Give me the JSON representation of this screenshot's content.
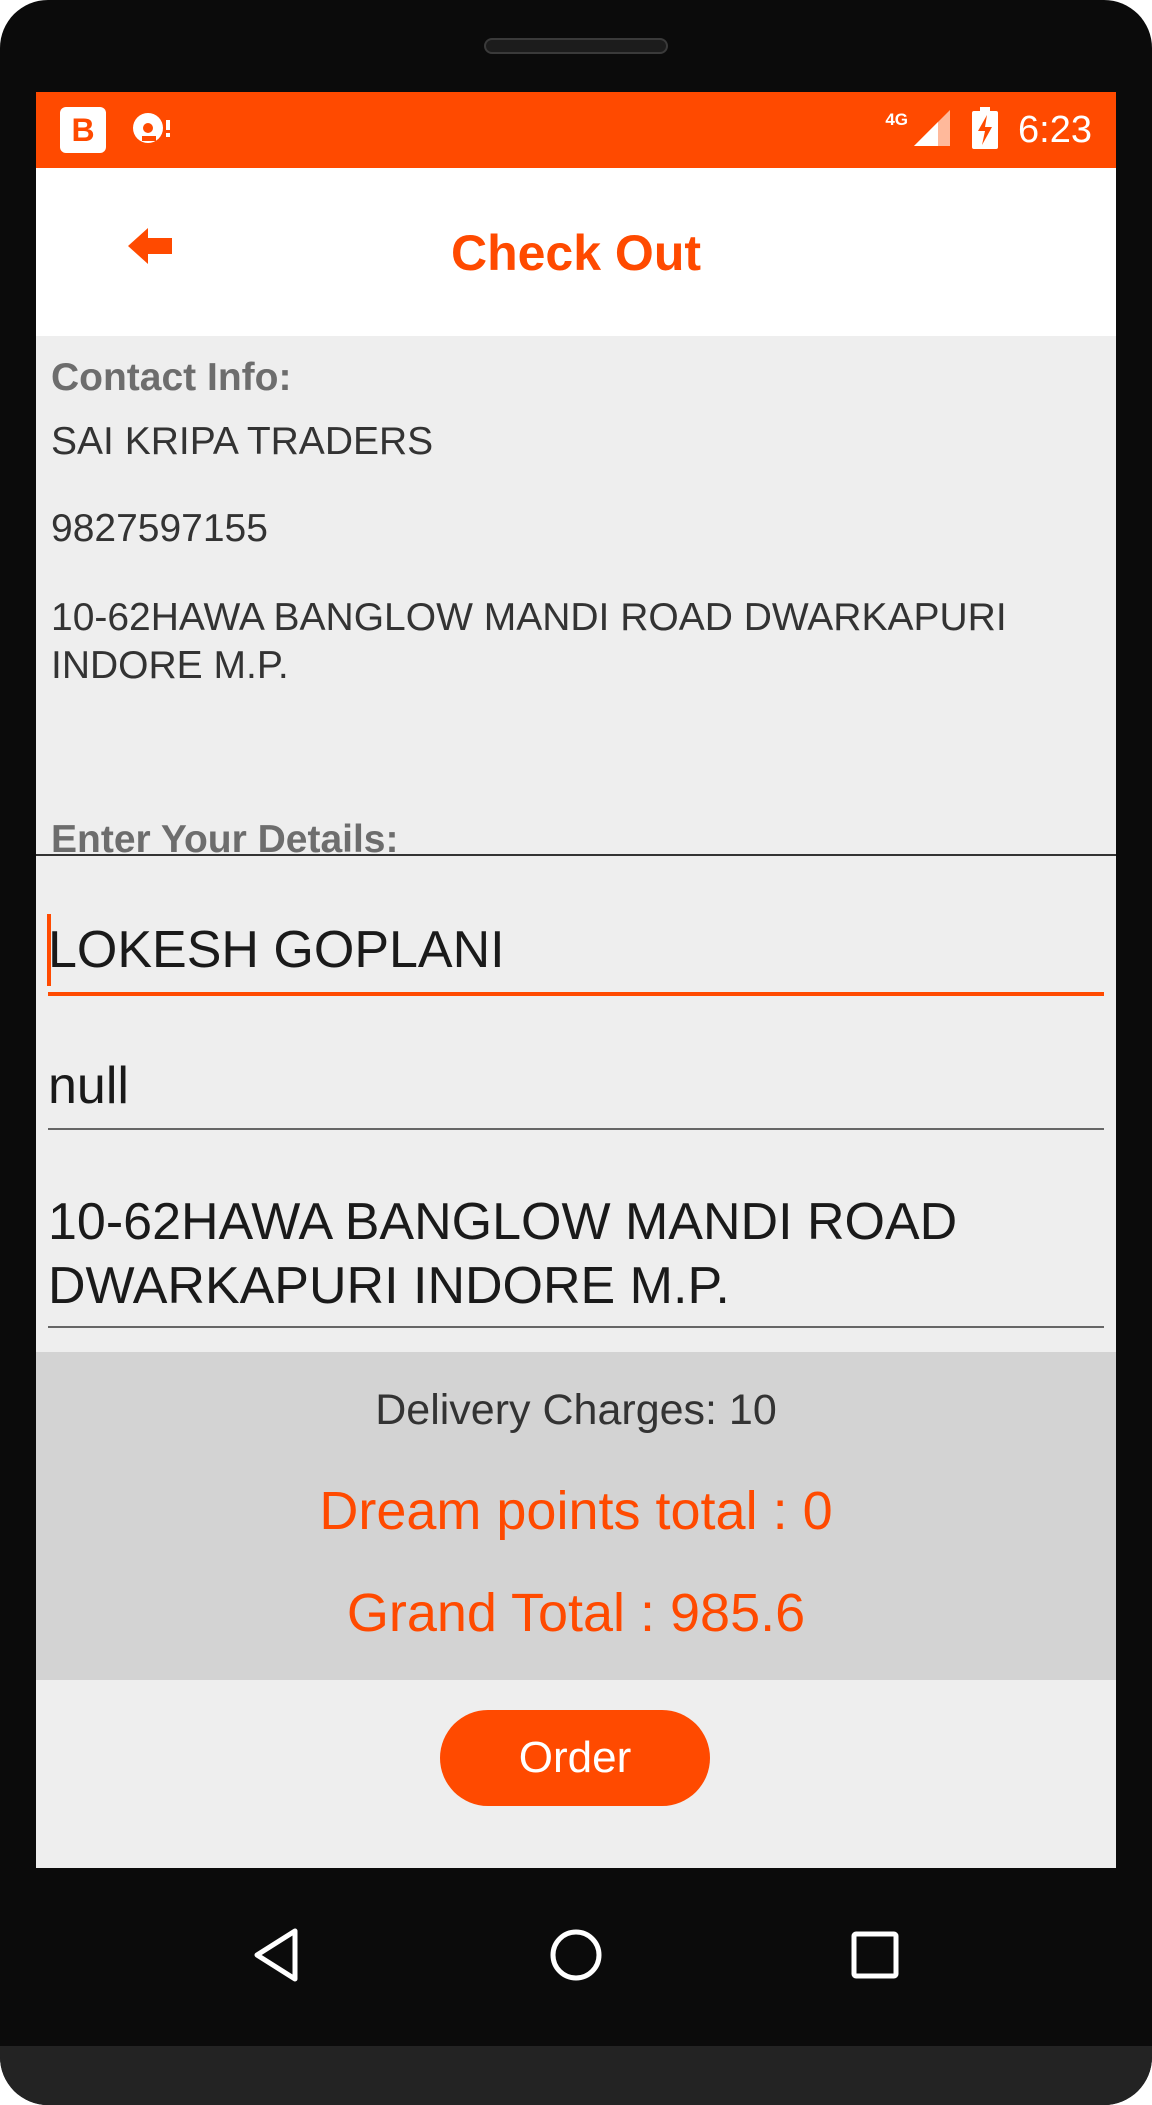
{
  "status_bar": {
    "network": "4G",
    "time": "6:23",
    "app_icon_letter": "B",
    "bg_color": "#ff4a00"
  },
  "header": {
    "title": "Check Out",
    "back_icon": "back-arrow-icon"
  },
  "contact": {
    "heading": "Contact Info:",
    "name": "SAI KRIPA TRADERS",
    "phone": "9827597155",
    "address": "10-62HAWA BANGLOW MANDI ROAD DWARKAPURI INDORE M.P."
  },
  "details": {
    "heading": "Enter Your Details:",
    "name_value": "LOKESH GOPLANI",
    "phone_value": "null",
    "address_value": "10-62HAWA BANGLOW MANDI ROAD DWARKAPURI INDORE M.P."
  },
  "totals": {
    "delivery": "Delivery Charges: 10",
    "dream_points": "Dream points total : 0",
    "grand_total": "Grand Total : 985.6"
  },
  "actions": {
    "order_label": "Order"
  },
  "nav_icons": [
    "back-triangle-icon",
    "home-circle-icon",
    "recents-square-icon"
  ],
  "colors": {
    "accent": "#ff4a00",
    "totals_bg": "#d3d3d3",
    "screen_bg": "#eeeeee"
  }
}
